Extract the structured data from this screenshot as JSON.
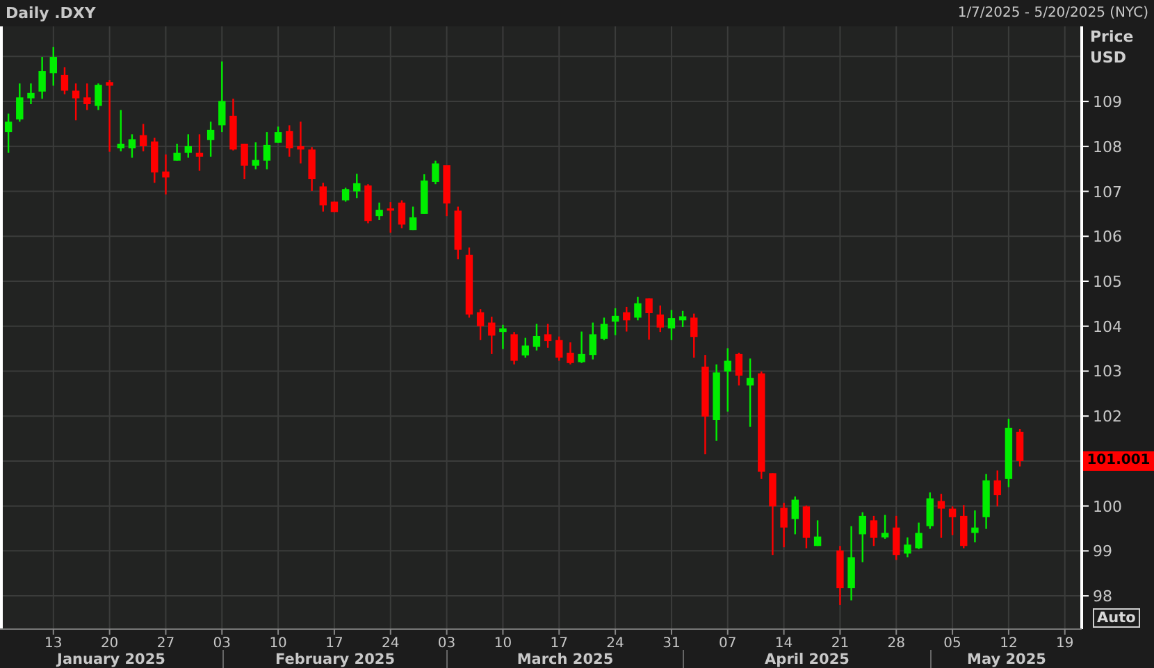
{
  "header": {
    "title": "Daily .DXY",
    "range": "1/7/2025 - 5/20/2025 (NYC)"
  },
  "chart": {
    "scale_button": "Auto",
    "last_price": "101.001",
    "chart_data": {
      "type": "candlestick",
      "ylabel": "Price USD",
      "grid": true,
      "ylim": [
        97.26,
        110.67
      ],
      "yticks": [
        98,
        99,
        100,
        102,
        103,
        104,
        105,
        106,
        107,
        108,
        109
      ],
      "categories": [
        null,
        null,
        null,
        null,
        "13",
        null,
        null,
        null,
        null,
        "20",
        null,
        null,
        null,
        null,
        "27",
        null,
        null,
        null,
        null,
        "03",
        null,
        null,
        null,
        null,
        "10",
        null,
        null,
        null,
        null,
        "17",
        null,
        null,
        null,
        null,
        "24",
        null,
        null,
        null,
        null,
        "03",
        null,
        null,
        null,
        null,
        "10",
        null,
        null,
        null,
        null,
        "17",
        null,
        null,
        null,
        null,
        "24",
        null,
        null,
        null,
        null,
        "31",
        null,
        null,
        null,
        null,
        "07",
        null,
        null,
        null,
        null,
        "14",
        null,
        null,
        null,
        null,
        "21",
        null,
        null,
        null,
        null,
        "28",
        null,
        null,
        null,
        null,
        "05",
        null,
        null,
        null,
        null,
        "12",
        null,
        null,
        null,
        null,
        "19"
      ],
      "ohlc": [
        [
          108.32,
          108.73,
          107.86,
          108.55
        ],
        [
          108.6,
          109.4,
          108.55,
          109.09
        ],
        [
          109.07,
          109.4,
          108.94,
          109.19
        ],
        [
          109.22,
          109.99,
          109.06,
          109.68
        ],
        [
          109.63,
          110.21,
          109.35,
          109.99
        ],
        [
          109.59,
          109.76,
          109.16,
          109.24
        ],
        [
          109.24,
          109.4,
          108.58,
          109.07
        ],
        [
          109.09,
          109.4,
          108.81,
          108.94
        ],
        [
          108.9,
          109.4,
          108.81,
          109.37
        ],
        [
          109.43,
          109.48,
          107.88,
          109.35
        ],
        [
          107.96,
          108.81,
          107.89,
          108.06
        ],
        [
          107.96,
          108.27,
          107.75,
          108.16
        ],
        [
          108.25,
          108.5,
          107.89,
          108.01
        ],
        [
          108.11,
          108.19,
          107.19,
          107.42
        ],
        [
          107.44,
          107.82,
          106.93,
          107.31
        ],
        [
          107.68,
          108.06,
          107.68,
          107.86
        ],
        [
          107.86,
          108.27,
          107.75,
          108.01
        ],
        [
          107.86,
          108.27,
          107.46,
          107.77
        ],
        [
          108.14,
          108.55,
          107.77,
          108.37
        ],
        [
          108.47,
          109.89,
          108.32,
          109.01
        ],
        [
          108.68,
          109.06,
          107.91,
          107.93
        ],
        [
          108.06,
          108.06,
          107.27,
          107.57
        ],
        [
          107.57,
          108.09,
          107.49,
          107.7
        ],
        [
          107.68,
          108.32,
          107.49,
          108.03
        ],
        [
          108.08,
          108.44,
          108.08,
          108.32
        ],
        [
          108.34,
          108.47,
          107.77,
          107.96
        ],
        [
          108.01,
          108.55,
          107.62,
          107.93
        ],
        [
          107.93,
          107.98,
          107.01,
          107.27
        ],
        [
          107.11,
          107.19,
          106.55,
          106.69
        ],
        [
          106.77,
          106.77,
          106.54,
          106.54
        ],
        [
          106.8,
          107.08,
          106.77,
          107.05
        ],
        [
          107.0,
          107.39,
          106.85,
          107.18
        ],
        [
          107.13,
          107.16,
          106.29,
          106.34
        ],
        [
          106.45,
          106.75,
          106.36,
          106.59
        ],
        [
          106.62,
          106.76,
          106.08,
          106.57
        ],
        [
          106.75,
          106.8,
          106.18,
          106.26
        ],
        [
          106.14,
          106.66,
          106.14,
          106.42
        ],
        [
          106.5,
          107.38,
          106.5,
          107.24
        ],
        [
          107.21,
          107.68,
          107.16,
          107.62
        ],
        [
          107.58,
          107.58,
          106.45,
          106.73
        ],
        [
          106.57,
          106.66,
          105.49,
          105.7
        ],
        [
          105.59,
          105.75,
          104.19,
          104.26
        ],
        [
          104.31,
          104.38,
          103.69,
          104.0
        ],
        [
          104.08,
          104.21,
          103.38,
          103.79
        ],
        [
          103.87,
          104.03,
          103.49,
          103.95
        ],
        [
          103.82,
          103.87,
          103.15,
          103.23
        ],
        [
          103.35,
          103.74,
          103.3,
          103.57
        ],
        [
          103.54,
          104.05,
          103.46,
          103.78
        ],
        [
          103.82,
          104.05,
          103.52,
          103.67
        ],
        [
          103.69,
          103.77,
          103.23,
          103.3
        ],
        [
          103.41,
          103.64,
          103.15,
          103.18
        ],
        [
          103.2,
          103.88,
          103.18,
          103.38
        ],
        [
          103.36,
          104.08,
          103.26,
          103.82
        ],
        [
          103.72,
          104.19,
          103.69,
          104.05
        ],
        [
          104.1,
          104.4,
          103.8,
          104.23
        ],
        [
          104.31,
          104.43,
          103.88,
          104.13
        ],
        [
          104.19,
          104.65,
          104.13,
          104.51
        ],
        [
          104.62,
          104.62,
          103.7,
          104.29
        ],
        [
          104.26,
          104.46,
          103.87,
          103.97
        ],
        [
          103.95,
          104.36,
          103.69,
          104.18
        ],
        [
          104.13,
          104.34,
          103.98,
          104.22
        ],
        [
          104.19,
          104.28,
          103.3,
          103.76
        ],
        [
          103.1,
          103.36,
          101.15,
          101.99
        ],
        [
          101.91,
          103.15,
          101.45,
          102.97
        ],
        [
          102.99,
          103.51,
          102.1,
          103.23
        ],
        [
          103.38,
          103.41,
          102.68,
          102.9
        ],
        [
          102.68,
          103.28,
          101.76,
          102.85
        ],
        [
          102.95,
          102.99,
          100.6,
          100.76
        ],
        [
          100.73,
          100.73,
          98.91,
          99.99
        ],
        [
          99.96,
          100.07,
          99.08,
          99.52
        ],
        [
          99.71,
          100.21,
          99.37,
          100.14
        ],
        [
          99.99,
          100.01,
          99.06,
          99.29
        ],
        [
          99.11,
          99.68,
          99.11,
          99.32
        ],
        null,
        [
          99.01,
          99.11,
          97.8,
          98.17
        ],
        [
          98.17,
          99.55,
          97.9,
          98.86
        ],
        [
          99.37,
          99.86,
          98.75,
          99.78
        ],
        [
          99.68,
          99.78,
          99.11,
          99.29
        ],
        [
          99.3,
          99.8,
          99.27,
          99.4
        ],
        [
          99.52,
          99.78,
          98.8,
          98.91
        ],
        [
          98.94,
          99.3,
          98.86,
          99.14
        ],
        [
          99.06,
          99.63,
          99.04,
          99.4
        ],
        [
          99.55,
          100.3,
          99.49,
          100.17
        ],
        [
          100.11,
          100.27,
          99.29,
          99.94
        ],
        [
          99.94,
          99.99,
          99.35,
          99.75
        ],
        [
          99.78,
          100.02,
          99.06,
          99.11
        ],
        [
          99.4,
          99.9,
          99.19,
          99.52
        ],
        [
          99.75,
          100.71,
          99.49,
          100.57
        ],
        [
          100.57,
          100.79,
          99.99,
          100.24
        ],
        [
          100.6,
          101.94,
          100.42,
          101.74
        ],
        [
          101.65,
          101.71,
          100.88,
          101.0
        ],
        null,
        null,
        null,
        null
      ]
    },
    "months": [
      "January 2025",
      "February 2025",
      "March 2025",
      "April 2025",
      "May 2025"
    ]
  }
}
